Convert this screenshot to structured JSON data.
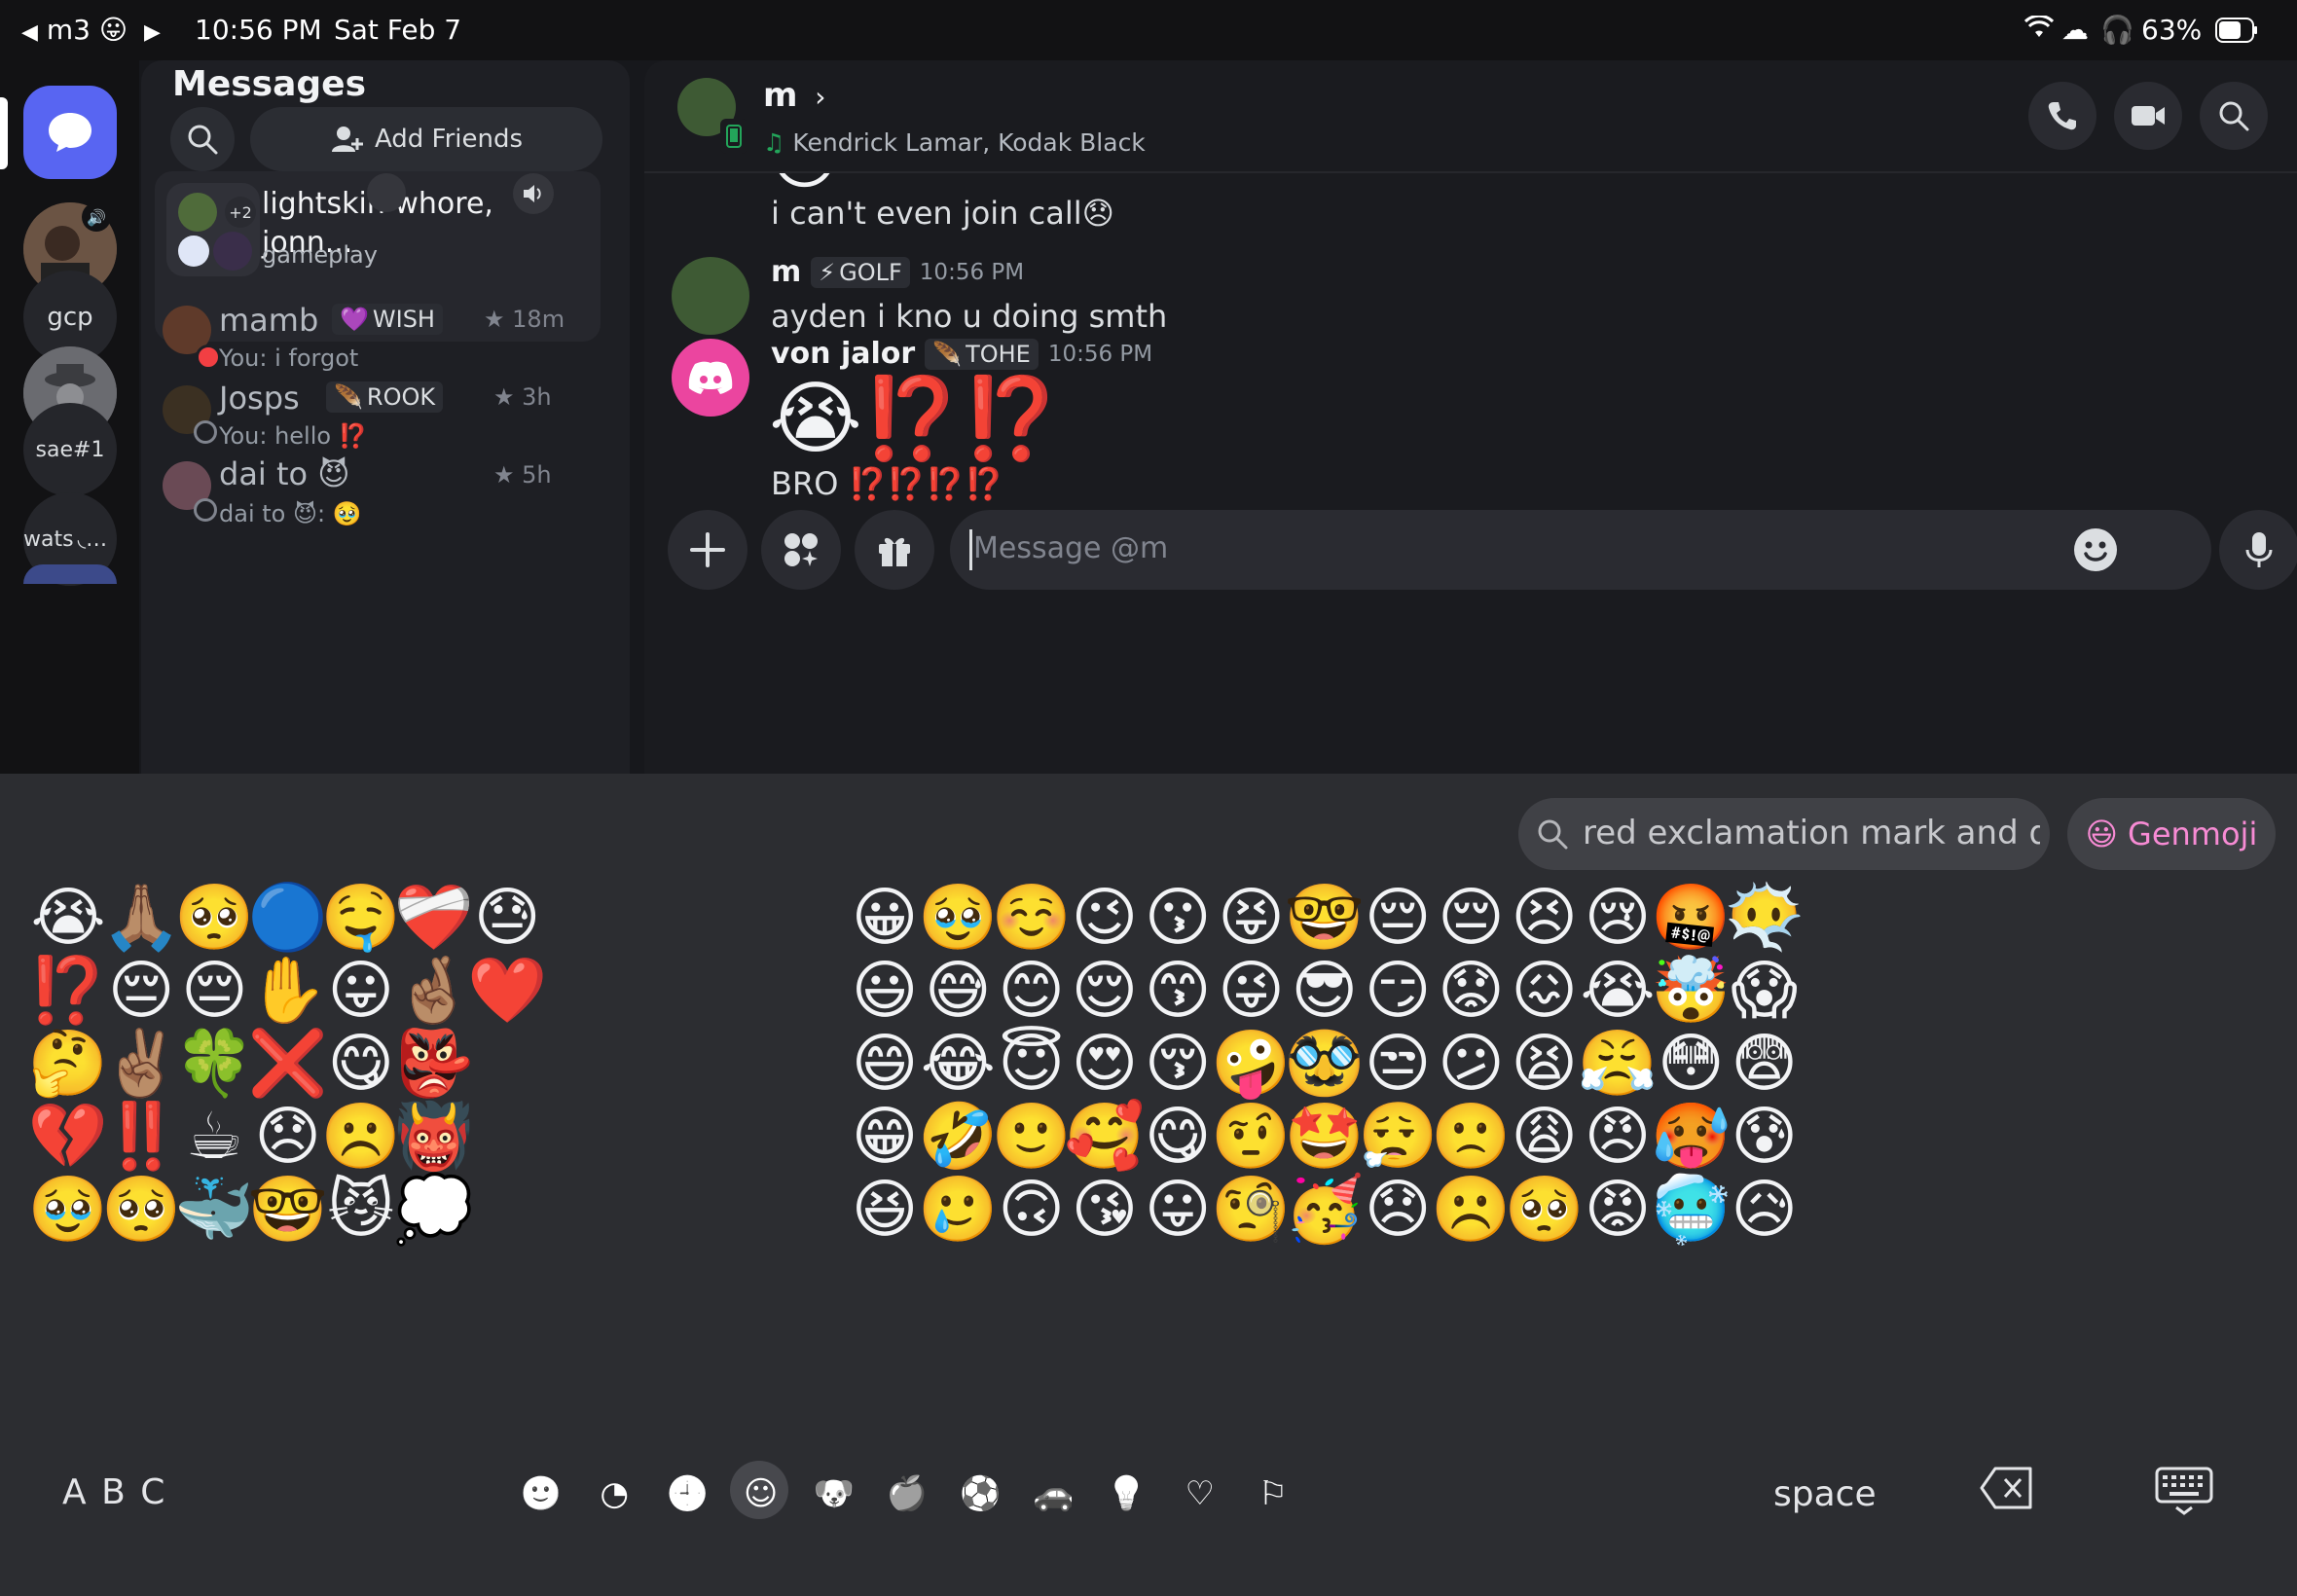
{
  "status_bar": {
    "back_label": "m3",
    "back_emoji": "😛",
    "time": "10:56 PM",
    "date": "Sat Feb 7",
    "battery": "63%"
  },
  "rail": {
    "items": [
      {
        "label": "gcp"
      },
      {
        "label": "sae#1"
      },
      {
        "label": "wats"
      }
    ]
  },
  "dm_panel": {
    "title": "Messages",
    "add_friends": "Add Friends",
    "group": {
      "name": "lightskin whore, jonn...",
      "subtitle": "gameplay",
      "extra_count": "+2"
    },
    "dms": [
      {
        "name": "mamb",
        "tag": "WISH",
        "time": "18m",
        "preview": "You: i forgot"
      },
      {
        "name": "Josps",
        "tag": "ROOK",
        "time": "3h",
        "preview": "You: hello ⁉️"
      },
      {
        "name": "dai to 😈",
        "tag": "",
        "time": "5h",
        "preview": "dai to 😈: 🥹"
      }
    ]
  },
  "chat": {
    "header": {
      "name": "m",
      "activity": "Kendrick Lamar, Kodak Black"
    },
    "messages": [
      {
        "author": "",
        "tag": "",
        "time": "",
        "text": "i can't even join call😞"
      },
      {
        "author": "m",
        "tag": "GOLF",
        "time": "10:56 PM",
        "text": "ayden i kno u doing smth"
      },
      {
        "author": "von jalor",
        "tag": "TOHE",
        "time": "10:56 PM",
        "jumbo": "😭⁉️⁉️",
        "text": "BRO ⁉️⁉️⁉️⁉️"
      }
    ],
    "input_placeholder": "Message @m"
  },
  "keyboard": {
    "search_text": "red exclamation mark and qu...",
    "genmoji_label": "Genmoji",
    "abc_label": "A B C",
    "space_label": "space",
    "recent": [
      [
        "😭",
        "🙏🏽",
        "🥺",
        "🔵",
        "🤤",
        "❤️‍🩹",
        "😓"
      ],
      [
        "⁉️",
        "😔",
        "😔",
        "✋",
        "😛",
        "🤞🏽",
        "❤️"
      ],
      [
        "🤔",
        "✌🏽",
        "🍀",
        "❌",
        "😋",
        "👺",
        ""
      ],
      [
        "💔",
        "‼️",
        "☕",
        "😞",
        "☹️",
        "👹",
        ""
      ],
      [
        "🥹",
        "🥺",
        "🐳",
        "🤓",
        "😼",
        "💭",
        ""
      ]
    ],
    "smileys": [
      [
        "😀",
        "🥹",
        "☺️",
        "😉",
        "😗",
        "😝",
        "🤓",
        "😔",
        "😔",
        "😣",
        "😢",
        "🤬",
        "😶‍🌫️"
      ],
      [
        "😃",
        "😅",
        "😊",
        "😌",
        "😙",
        "😜",
        "😎",
        "😏",
        "😟",
        "😖",
        "😭",
        "🤯",
        "😱"
      ],
      [
        "😄",
        "😂",
        "😇",
        "😍",
        "😚",
        "🤪",
        "🥸",
        "😒",
        "😕",
        "😫",
        "😤",
        "😳",
        "😨"
      ],
      [
        "😁",
        "🤣",
        "🙂",
        "🥰",
        "😋",
        "🤨",
        "🤩",
        "😮‍💨",
        "🙁",
        "😩",
        "😠",
        "🥵",
        "😰"
      ],
      [
        "😆",
        "🥲",
        "🙃",
        "😘",
        "😛",
        "🧐",
        "🥳",
        "😞",
        "☹️",
        "🥺",
        "😡",
        "🥶",
        "😥"
      ]
    ],
    "categories": [
      "memoji-icon",
      "clock-sticker-icon",
      "recent-icon",
      "smileys-icon",
      "animals-icon",
      "food-icon",
      "activity-icon",
      "travel-icon",
      "objects-icon",
      "symbols-icon",
      "flags-icon"
    ]
  }
}
